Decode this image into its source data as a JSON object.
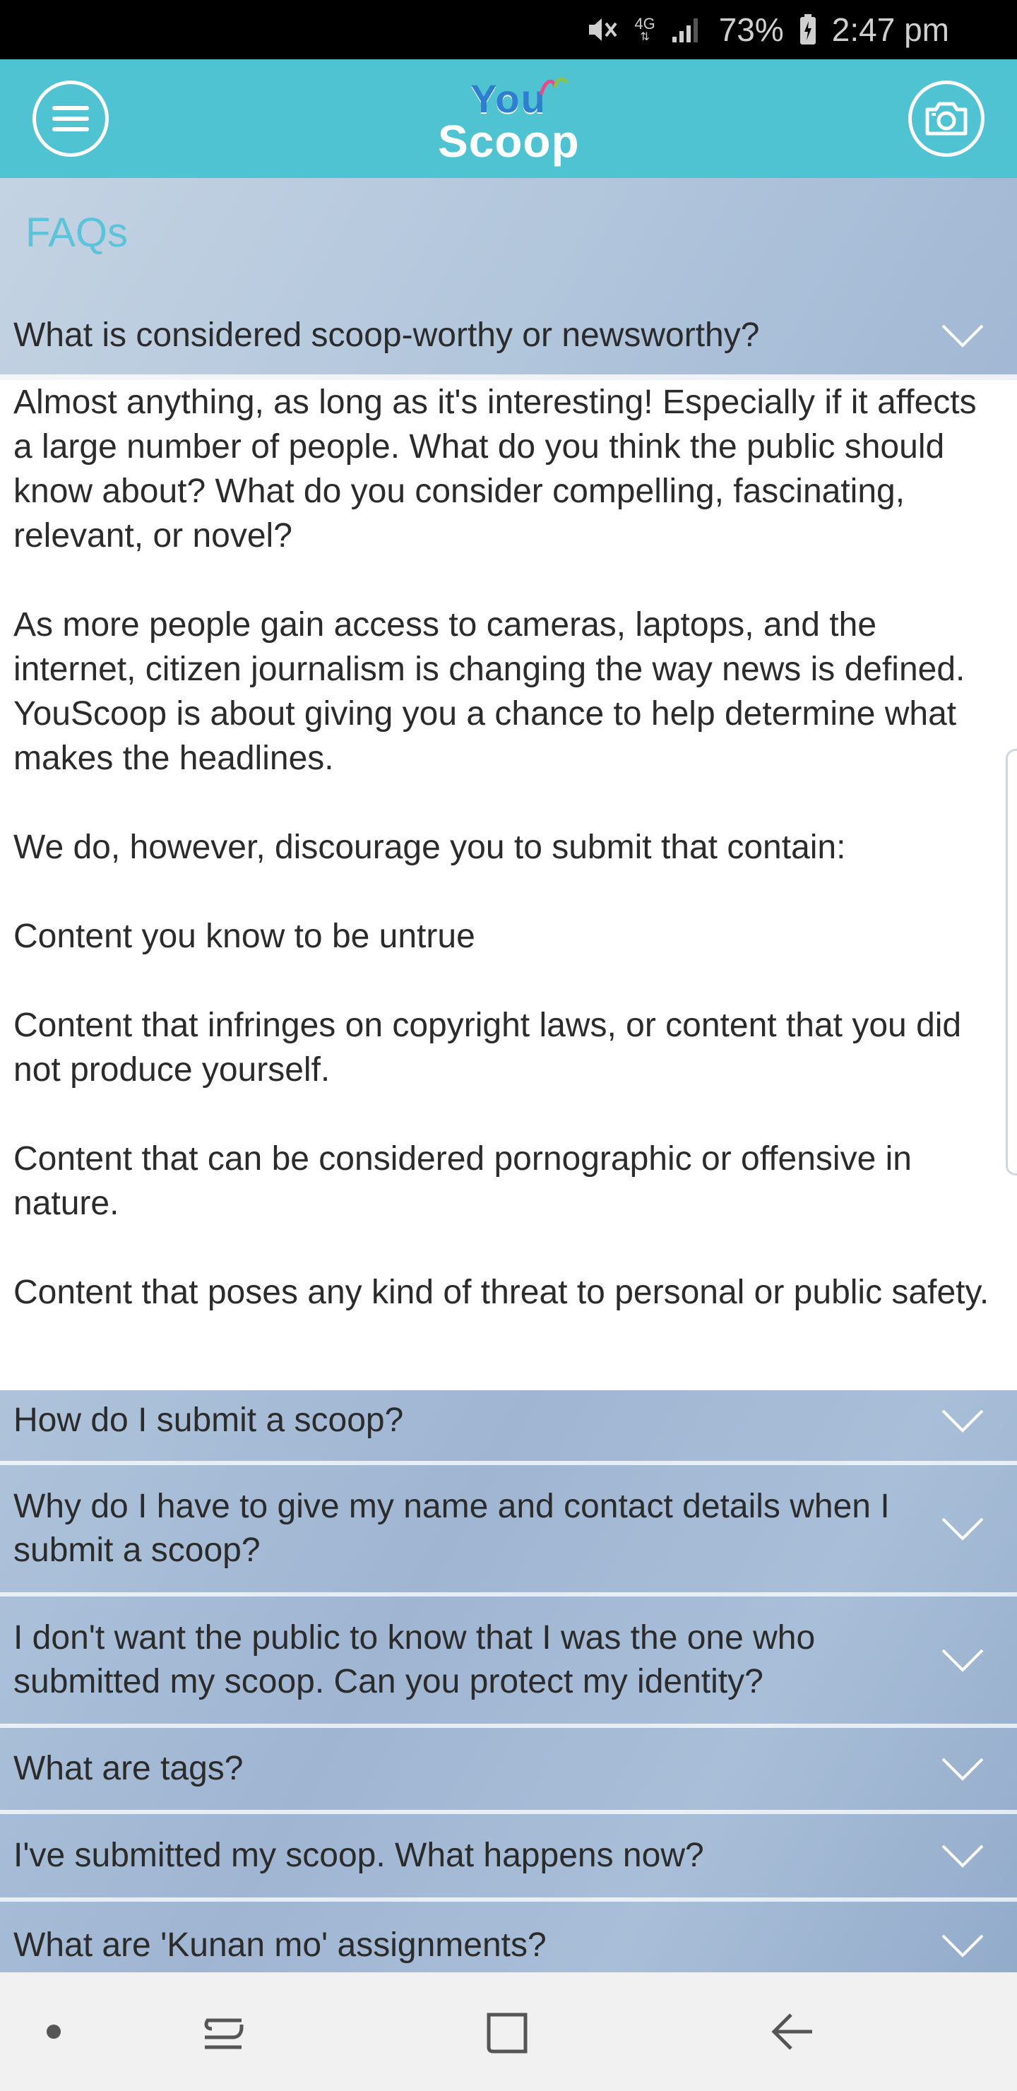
{
  "status_bar": {
    "battery": "73%",
    "time": "2:47 pm",
    "network": "4G",
    "icons": [
      "mute-icon",
      "network-4g-icon",
      "signal-icon",
      "battery-icon"
    ]
  },
  "header": {
    "logo_top": "You",
    "logo_bottom": "Scoop",
    "icons": [
      "menu-icon",
      "camera-icon"
    ],
    "accent_color": "#4fc3d2"
  },
  "faq": {
    "title": "FAQs",
    "title_color": "#5cc3d8",
    "expanded_question": "What is considered scoop-worthy or newsworthy?",
    "answer_paragraphs": [
      "Almost anything, as long as it's interesting! Especially if it affects a large number of people. What do you think the public should know about? What do you consider compelling, fascinating, relevant, or novel?",
      "As more people gain access to cameras, laptops, and the internet, citizen journalism is changing the way news is defined. YouScoop is about giving you a chance to help determine what makes the headlines.",
      "We do, however, discourage you to submit that contain:",
      "Content you know to be untrue",
      "Content that infringes on copyright laws, or content that you did not produce yourself.",
      "Content that can be considered pornographic or offensive in nature.",
      "Content that poses any kind of threat to personal or public safety."
    ],
    "questions": [
      "How do I submit a scoop?",
      "Why do I have to give my name and contact details when I submit a scoop?",
      "I don't want the public to know that I was the one who submitted my scoop. Can you protect my identity?",
      "What are tags?",
      "I've submitted my scoop. What happens now?",
      "What are 'Kunan mo' assignments?"
    ]
  },
  "nav_bar": {
    "icons": [
      "dot-icon",
      "recents-icon",
      "home-icon",
      "back-icon"
    ]
  }
}
